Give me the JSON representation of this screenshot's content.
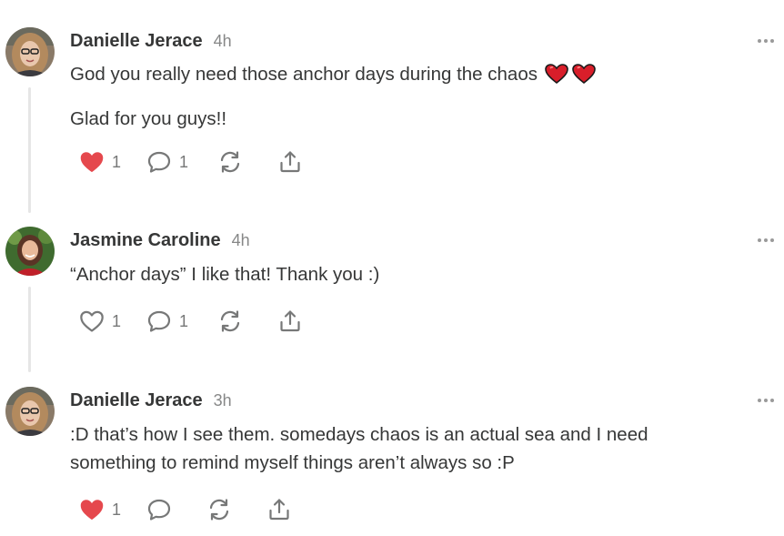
{
  "comments": [
    {
      "author": "Danielle Jerace",
      "time": "4h",
      "paragraphs": [
        "God you really need those anchor days during the chaos",
        "Glad for you guys!!"
      ],
      "emoji_after_first": [
        "red-heart",
        "red-heart"
      ],
      "liked": true,
      "like_count": "1",
      "reply_count": "1"
    },
    {
      "author": "Jasmine Caroline",
      "time": "4h",
      "paragraphs": [
        "“Anchor days” I like that! Thank you :)"
      ],
      "liked": false,
      "like_count": "1",
      "reply_count": "1"
    },
    {
      "author": "Danielle Jerace",
      "time": "3h",
      "paragraphs": [
        ":D that’s how I see them. somedays chaos is an actual sea and I need something to remind myself things aren’t always so :P"
      ],
      "liked": true,
      "like_count": "1",
      "reply_count": ""
    }
  ],
  "colors": {
    "liked_heart": "#e5484d",
    "icon": "#777878",
    "text": "#363737",
    "meta": "#868787",
    "thread_line": "#e6e6e6"
  },
  "icons": [
    "heart-icon",
    "comment-icon",
    "restack-icon",
    "share-icon",
    "more-icon"
  ]
}
